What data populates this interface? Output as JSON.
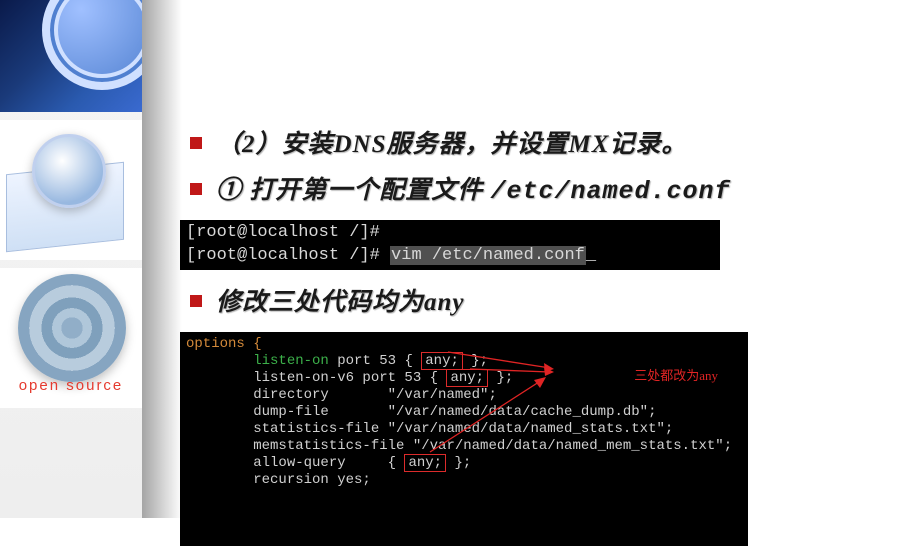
{
  "sidebar": {
    "open_source_label": "open source"
  },
  "bullets": [
    {
      "text": "（2）安装DNS服务器，并设置MX记录。"
    },
    {
      "text": "① 打开第一个配置文件 ",
      "code": "/etc/named.conf"
    },
    {
      "text": "修改三处代码均为any"
    }
  ],
  "terminal1": {
    "line1": "[root@localhost /]#",
    "line2_prompt": "[root@localhost /]# ",
    "line2_cmd": "vim /etc/named.conf",
    "cursor": "_"
  },
  "terminal2": {
    "lines": [
      {
        "raw": "options {",
        "class": "t2-orange"
      },
      {
        "prefix": "        ",
        "green": "listen-on",
        "after_green": " port 53 { ",
        "boxed": "any;",
        "tail": " };"
      },
      {
        "prefix": "        listen-on-v6 port 53 { ",
        "boxed": "any;",
        "tail": " };"
      },
      {
        "prefix": "        directory       \"/var/named\";"
      },
      {
        "prefix": "        dump-file       \"/var/named/data/cache_dump.db\";"
      },
      {
        "prefix": "        statistics-file \"/var/named/data/named_stats.txt\";"
      },
      {
        "prefix": "        memstatistics-file \"/var/named/data/named_mem_stats.txt\";"
      },
      {
        "prefix": "        allow-query     { ",
        "boxed": "any;",
        "tail": " };"
      },
      {
        "prefix": "        recursion yes;"
      }
    ],
    "annotation": "三处都改为any"
  }
}
